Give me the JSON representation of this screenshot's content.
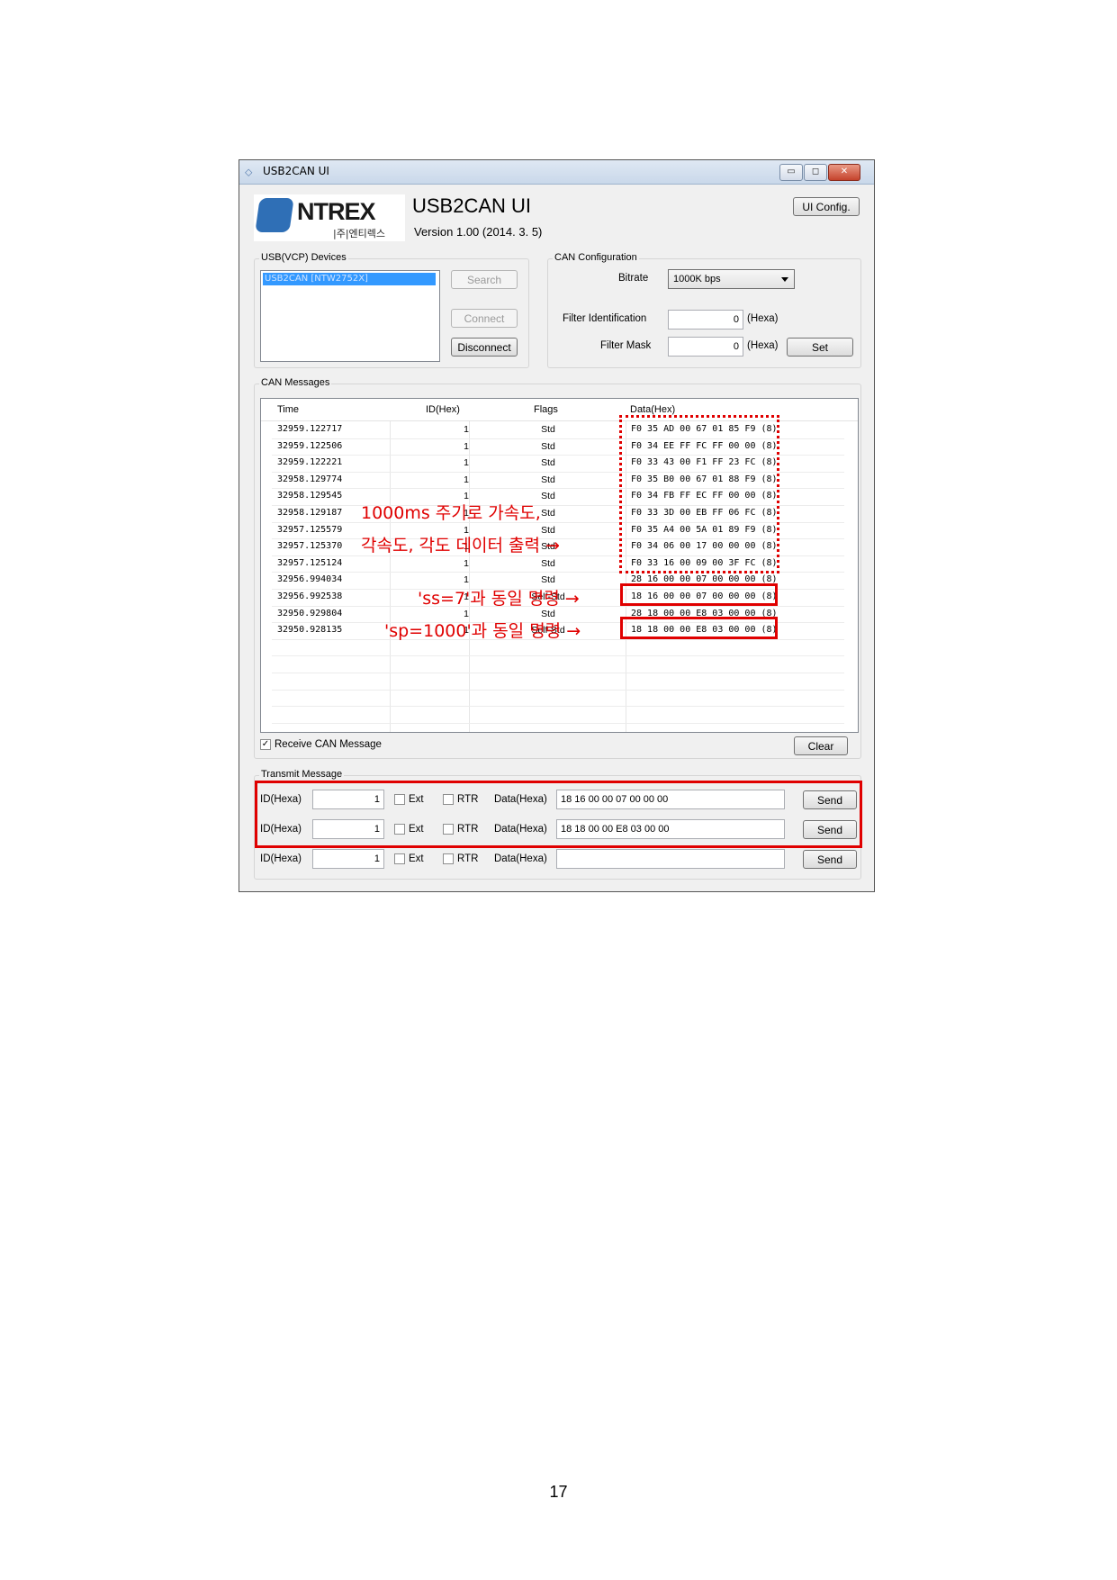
{
  "window": {
    "title": "USB2CAN UI",
    "controls": {
      "minimize": "▭",
      "maximize": "◻",
      "close": "✕"
    }
  },
  "header": {
    "logo_brand": "NTREX",
    "logo_sub": "|주|엔티렉스",
    "app_title": "USB2CAN UI",
    "version": "Version 1.00 (2014. 3. 5)",
    "ui_config_label": "UI Config."
  },
  "usb_devices": {
    "group_label": "USB(VCP) Devices",
    "items": [
      "USB2CAN [NTW2752X]"
    ],
    "search_label": "Search",
    "connect_label": "Connect",
    "disconnect_label": "Disconnect"
  },
  "can_config": {
    "group_label": "CAN Configuration",
    "bitrate_label": "Bitrate",
    "bitrate_value": "1000K bps",
    "filter_id_label": "Filter Identification",
    "filter_id_value": "0",
    "filter_id_unit": "(Hexa)",
    "filter_mask_label": "Filter Mask",
    "filter_mask_value": "0",
    "filter_mask_unit": "(Hexa)",
    "set_label": "Set"
  },
  "can_messages": {
    "group_label": "CAN Messages",
    "columns": [
      "Time",
      "ID(Hex)",
      "Flags",
      "Data(Hex)"
    ],
    "rows": [
      {
        "time": "32959.122717",
        "id": "1",
        "flags": "Std",
        "data": "F0 35 AD 00 67 01 85 F9 (8)"
      },
      {
        "time": "32959.122506",
        "id": "1",
        "flags": "Std",
        "data": "F0 34 EE FF FC FF 00 00 (8)"
      },
      {
        "time": "32959.122221",
        "id": "1",
        "flags": "Std",
        "data": "F0 33 43 00 F1 FF 23 FC (8)"
      },
      {
        "time": "32958.129774",
        "id": "1",
        "flags": "Std",
        "data": "F0 35 B0 00 67 01 88 F9 (8)"
      },
      {
        "time": "32958.129545",
        "id": "1",
        "flags": "Std",
        "data": "F0 34 FB FF EC FF 00 00 (8)"
      },
      {
        "time": "32958.129187",
        "id": "1",
        "flags": "Std",
        "data": "F0 33 3D 00 EB FF 06 FC (8)"
      },
      {
        "time": "32957.125579",
        "id": "1",
        "flags": "Std",
        "data": "F0 35 A4 00 5A 01 89 F9 (8)"
      },
      {
        "time": "32957.125370",
        "id": "1",
        "flags": "Std",
        "data": "F0 34 06 00 17 00 00 00 (8)"
      },
      {
        "time": "32957.125124",
        "id": "1",
        "flags": "Std",
        "data": "F0 33 16 00 09 00 3F FC (8)"
      },
      {
        "time": "32956.994034",
        "id": "1",
        "flags": "Std",
        "data": "28 16 00 00 07 00 00 00 (8)"
      },
      {
        "time": "32956.992538",
        "id": "1",
        "flags": "Self-Std",
        "data": "18 16 00 00 07 00 00 00 (8)"
      },
      {
        "time": "32950.929804",
        "id": "1",
        "flags": "Std",
        "data": "28 18 00 00 E8 03 00 00 (8)"
      },
      {
        "time": "32950.928135",
        "id": "1",
        "flags": "Self-Std",
        "data": "18 18 00 00 E8 03 00 00 (8)"
      }
    ],
    "receive_label": "Receive CAN Message",
    "receive_checked": "✓",
    "clear_label": "Clear"
  },
  "annotations": {
    "line1": "1000ms 주기로 가속도,",
    "line2": "각속도, 각도 데이터 출력 →",
    "ss": "'ss=7'과 동일 명령 →",
    "sp": "'sp=1000'과 동일 명령 →",
    "color": "#e00000"
  },
  "transmit": {
    "group_label": "Transmit Message",
    "rows": [
      {
        "id_label": "ID(Hexa)",
        "id_value": "1",
        "ext_label": "Ext",
        "rtr_label": "RTR",
        "data_label": "Data(Hexa)",
        "data_value": "18 16 00 00 07 00 00 00",
        "send_label": "Send"
      },
      {
        "id_label": "ID(Hexa)",
        "id_value": "1",
        "ext_label": "Ext",
        "rtr_label": "RTR",
        "data_label": "Data(Hexa)",
        "data_value": "18 18 00 00 E8 03 00 00",
        "send_label": "Send"
      },
      {
        "id_label": "ID(Hexa)",
        "id_value": "1",
        "ext_label": "Ext",
        "rtr_label": "RTR",
        "data_label": "Data(Hexa)",
        "data_value": "",
        "send_label": "Send"
      }
    ]
  },
  "page_number": "17"
}
